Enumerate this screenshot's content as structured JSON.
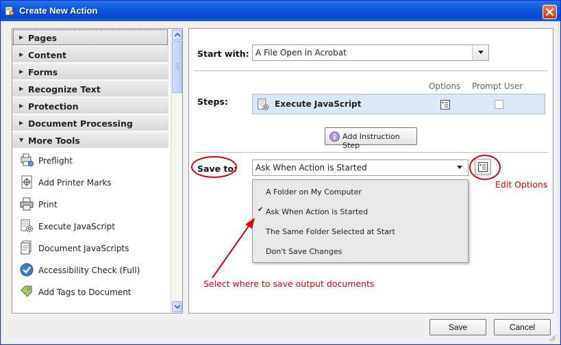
{
  "window": {
    "title": "Create New Action"
  },
  "categories": [
    {
      "label": "Pages",
      "arrow": "▶"
    },
    {
      "label": "Content",
      "arrow": "▶"
    },
    {
      "label": "Forms",
      "arrow": "▶"
    },
    {
      "label": "Recognize Text",
      "arrow": "▶"
    },
    {
      "label": "Protection",
      "arrow": "▶"
    },
    {
      "label": "Document Processing",
      "arrow": "▶"
    },
    {
      "label": "More Tools",
      "arrow": "▼"
    }
  ],
  "tools": [
    {
      "label": "Preflight",
      "icon": "preflight-icon"
    },
    {
      "label": "Add Printer Marks",
      "icon": "printer-marks-icon"
    },
    {
      "label": "Print",
      "icon": "printer-icon"
    },
    {
      "label": "Execute JavaScript",
      "icon": "javascript-gear-icon"
    },
    {
      "label": "Document JavaScripts",
      "icon": "document-javascript-icon"
    },
    {
      "label": "Accessibility Check (Full)",
      "icon": "accessibility-check-icon"
    },
    {
      "label": "Add Tags to Document",
      "icon": "tag-icon"
    }
  ],
  "start_with": {
    "label": "Start with:",
    "value": "A File Open in Acrobat"
  },
  "steps": {
    "label": "Steps:",
    "col_options": "Options",
    "col_prompt": "Prompt User",
    "rows": [
      {
        "label": "Execute JavaScript",
        "prompt_user": false
      }
    ],
    "add_step_label": "Add Instruction Step"
  },
  "save_to": {
    "label": "Save to:",
    "value": "Ask When Action is Started",
    "options": [
      {
        "label": "A Folder on My Computer",
        "selected": false
      },
      {
        "label": "Ask When Action is Started",
        "selected": true
      },
      {
        "label": "The Same Folder Selected at Start",
        "selected": false
      },
      {
        "label": "Don't Save Changes",
        "selected": false
      }
    ],
    "check_glyph": "✔"
  },
  "annotations": {
    "edit_options": "Edit Options",
    "select_where": "Select where to save output documents",
    "color": "#e00000"
  },
  "footer": {
    "save_label": "Save",
    "cancel_label": "Cancel"
  }
}
